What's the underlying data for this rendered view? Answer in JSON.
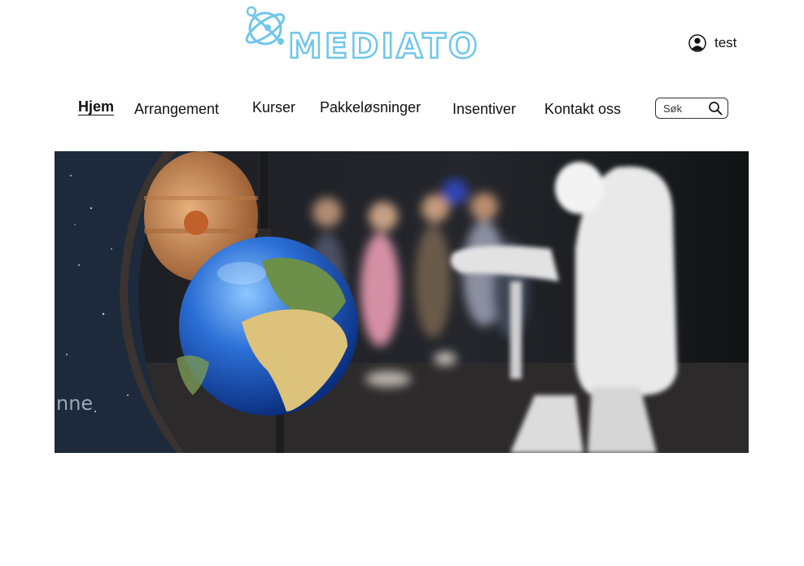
{
  "header": {
    "logo_text": "MEDIATO",
    "logo_icon": "atom-orbit-icon",
    "user": {
      "icon": "user-circle-icon",
      "name": "test"
    }
  },
  "nav": {
    "items": [
      {
        "label": "Hjem",
        "active": true
      },
      {
        "label": "Arrangement",
        "active": false
      },
      {
        "label": "Kurser",
        "active": false
      },
      {
        "label": "Pakkeløsninger",
        "active": false
      },
      {
        "label": "Insentiver",
        "active": false
      },
      {
        "label": "Kontakt oss",
        "active": false
      }
    ],
    "search": {
      "placeholder": "Søk",
      "icon": "search-icon"
    }
  },
  "hero": {
    "image": "Globe model in front of an astronaut costume and children in a space exhibit",
    "visible_text": "nne"
  },
  "colors": {
    "brand": "#71c6ea",
    "text": "#111111",
    "background": "#ffffff"
  }
}
